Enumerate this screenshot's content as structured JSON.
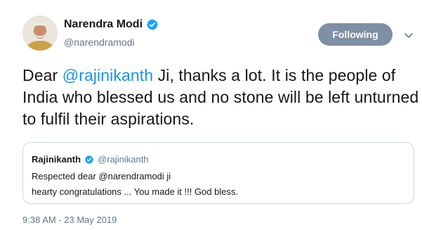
{
  "author": {
    "name": "Narendra Modi",
    "handle": "@narendramodi",
    "verified": true
  },
  "follow_button_label": "Following",
  "tweet_text": {
    "part1": "Dear ",
    "mention": "@rajinikanth",
    "part2": " Ji, thanks a lot. It is the people of India who blessed us and no stone will be left unturned to fulfil their aspirations."
  },
  "quoted_tweet": {
    "author_name": "Rajinikanth",
    "author_handle": "@rajinikanth",
    "verified": true,
    "line1": "Respected dear @narendramodi ji",
    "line2": "hearty congratulations ... You made it !!! God bless."
  },
  "timestamp": "9:38 AM - 23 May 2019",
  "colors": {
    "link": "#1b95e0",
    "verified": "#1da1f2",
    "follow_button_bg": "#7f8fa4",
    "muted_text": "#657786"
  },
  "icons": {
    "verified": "verified-badge-icon",
    "menu": "chevron-down-icon"
  }
}
